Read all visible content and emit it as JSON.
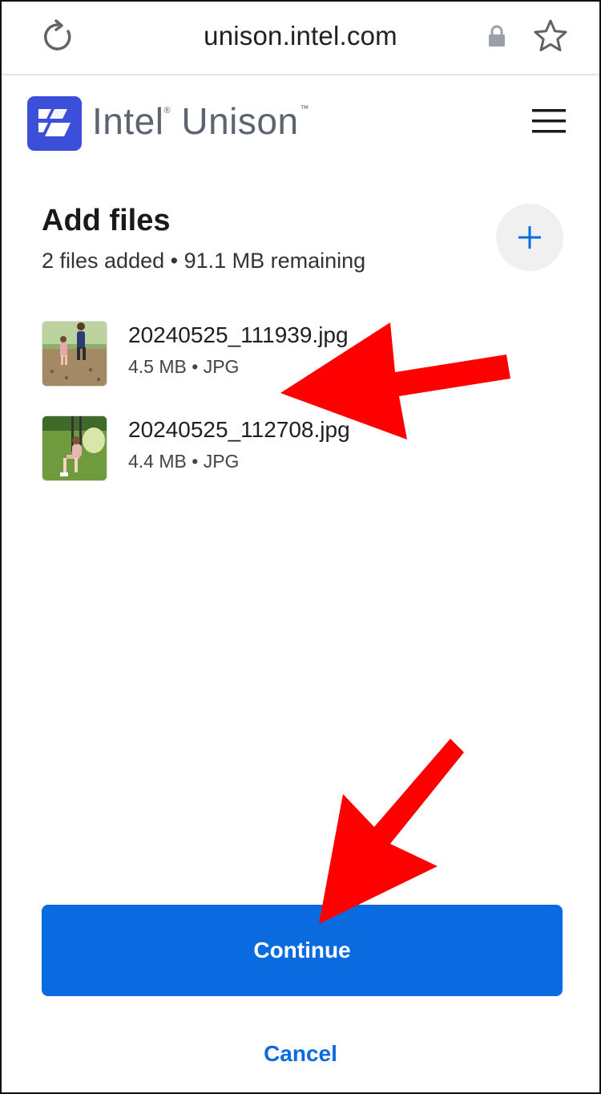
{
  "browser": {
    "url": "unison.intel.com",
    "icons": [
      "reload-icon",
      "lock-icon",
      "star-icon"
    ]
  },
  "header": {
    "brand_name": "Intel",
    "brand_registered": "®",
    "brand_product": " Unison",
    "brand_tm": "™",
    "icons": [
      "intel-unison-logo",
      "menu-icon"
    ]
  },
  "section": {
    "title": "Add files",
    "subtitle": "2 files added • 91.1 MB remaining",
    "add_icon": "plus-icon"
  },
  "files": [
    {
      "name": "20240525_111939.jpg",
      "meta": "4.5 MB • JPG"
    },
    {
      "name": "20240525_112708.jpg",
      "meta": "4.4 MB • JPG"
    }
  ],
  "actions": {
    "continue_label": "Continue",
    "cancel_label": "Cancel"
  },
  "colors": {
    "accent": "#0a6be0",
    "logo": "#3b4fd8",
    "annotation_arrow": "#ff0000"
  }
}
